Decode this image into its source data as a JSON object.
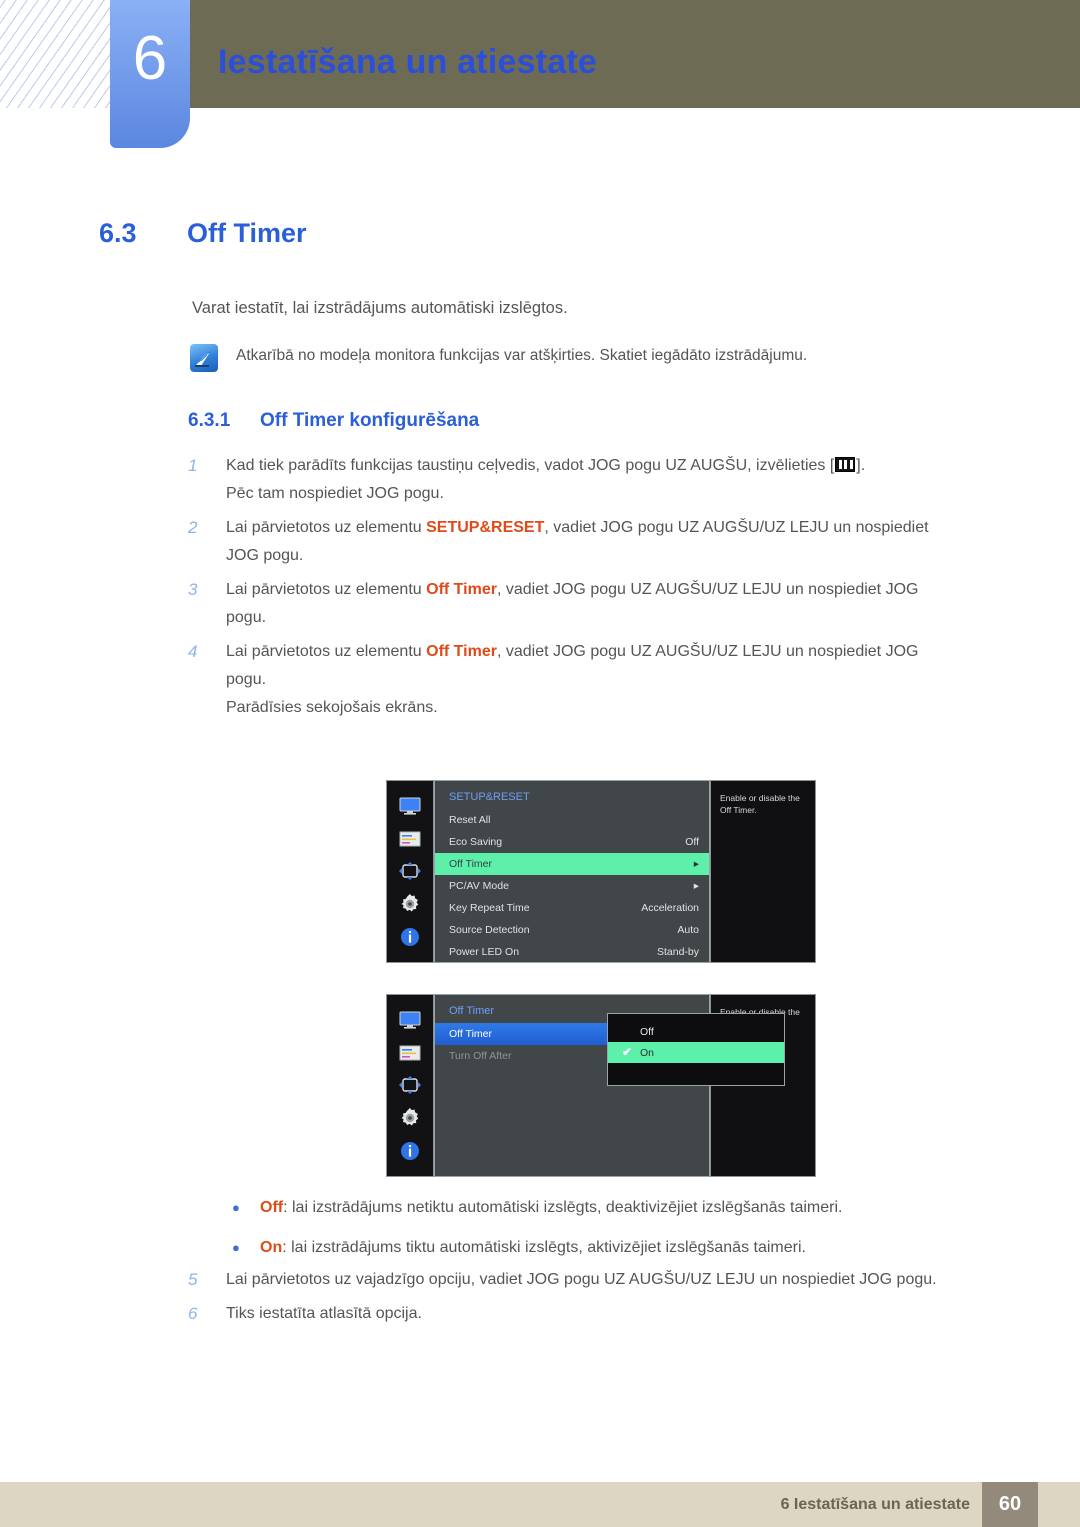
{
  "header": {
    "chapter_number": "6",
    "chapter_title": "Iestatīšana un atiestate",
    "band_color": "#6e6b55",
    "tab_color": "#5b87e0"
  },
  "section": {
    "number": "6.3",
    "title": "Off Timer",
    "intro": "Varat iestatīt, lai izstrādājums automātiski izslēgtos.",
    "note_icon": "quill-note-icon",
    "note": "Atkarībā no modeļa monitora funkcijas var atšķirties. Skatiet iegādāto izstrādājumu."
  },
  "subsection": {
    "number": "6.3.1",
    "title": "Off Timer konfigurēšana"
  },
  "steps": [
    {
      "num": "1",
      "line1_pre": "Kad tiek parādīts funkcijas taustiņu ceļvedis, vadot JOG pogu UZ AUGŠU, izvēlieties [",
      "line1_post": "].",
      "line2": "Pēc tam nospiediet JOG pogu."
    },
    {
      "num": "2",
      "line1_pre": "Lai pārvietotos uz elementu ",
      "highlight": "SETUP&RESET",
      "line1_post": ", vadiet JOG pogu UZ AUGŠU/UZ LEJU un nospiediet",
      "line2": "JOG pogu."
    },
    {
      "num": "3",
      "line1_pre": "Lai pārvietotos uz elementu ",
      "highlight": "Off Timer",
      "line1_post": ", vadiet JOG pogu UZ AUGŠU/UZ LEJU un nospiediet JOG",
      "line2": "pogu."
    },
    {
      "num": "4",
      "line1_pre": "Lai pārvietotos uz elementu ",
      "highlight": "Off Timer",
      "line1_post": ", vadiet JOG pogu UZ AUGŠU/UZ LEJU un nospiediet JOG",
      "line2": "pogu.",
      "line3": "Parādīsies sekojošais ekrāns."
    }
  ],
  "osd_setup_reset": {
    "rail_icons": [
      "monitor-icon",
      "picture-sliders-icon",
      "position-arrows-icon",
      "gear-icon",
      "info-icon"
    ],
    "title": "SETUP&RESET",
    "rows": [
      {
        "label": "Reset All",
        "value": "",
        "state": "normal"
      },
      {
        "label": "Eco Saving",
        "value": "Off",
        "state": "normal"
      },
      {
        "label": "Off Timer",
        "value": "▸",
        "state": "selected-green"
      },
      {
        "label": "PC/AV Mode",
        "value": "▸",
        "state": "normal"
      },
      {
        "label": "Key Repeat Time",
        "value": "Acceleration",
        "state": "normal"
      },
      {
        "label": "Source Detection",
        "value": "Auto",
        "state": "normal"
      },
      {
        "label": "Power LED On",
        "value": "Stand-by",
        "state": "normal"
      }
    ],
    "help": "Enable or disable the Off Timer."
  },
  "osd_off_timer": {
    "rail_icons": [
      "monitor-icon",
      "picture-sliders-icon",
      "position-arrows-icon",
      "gear-icon",
      "info-icon"
    ],
    "title": "Off Timer",
    "rows": [
      {
        "label": "Off Timer",
        "state": "selected-blue"
      },
      {
        "label": "Turn Off After",
        "state": "dim"
      }
    ],
    "popup": {
      "options": [
        {
          "label": "Off",
          "checked": false
        },
        {
          "label": "On",
          "checked": true
        }
      ],
      "check_glyph": "✔"
    },
    "help": "Enable or disable the Off Timer."
  },
  "bullets": [
    {
      "dot": "●",
      "highlight": "Off",
      "text": ": lai izstrādājums netiktu automātiski izslēgts, deaktivizējiet izslēgšanās taimeri."
    },
    {
      "dot": "●",
      "highlight": "On",
      "text": ": lai izstrādājums tiktu automātiski izslēgts, aktivizējiet izslēgšanās taimeri."
    }
  ],
  "steps_tail": [
    {
      "num": "5",
      "line1": "Lai pārvietotos uz vajadzīgo opciju, vadiet JOG pogu UZ AUGŠU/UZ LEJU un nospiediet JOG pogu."
    },
    {
      "num": "6",
      "line1": "Tiks iestatīta atlasītā opcija."
    }
  ],
  "footer": {
    "text": "6 Iestatīšana un atiestate",
    "page": "60",
    "bar_color": "#dcd6c2",
    "page_color": "#938a7c"
  }
}
